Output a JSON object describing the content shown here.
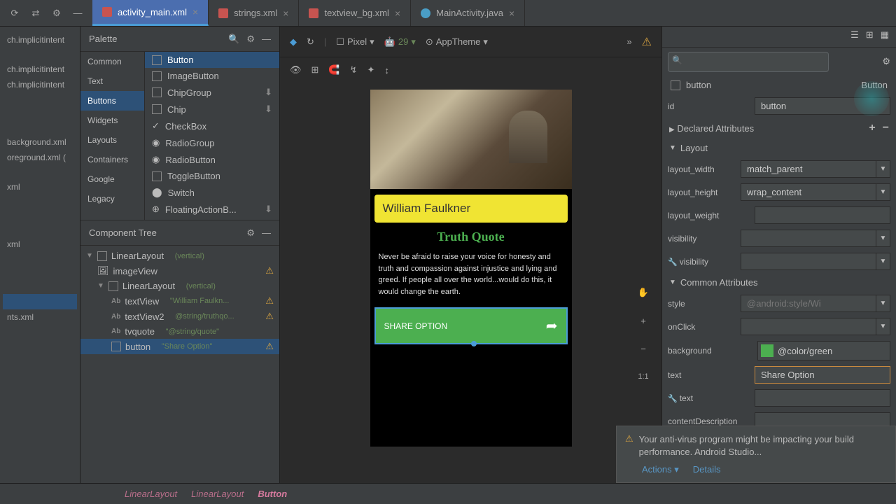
{
  "tabs": [
    {
      "label": "activity_main.xml",
      "active": true,
      "type": "xml"
    },
    {
      "label": "strings.xml",
      "active": false,
      "type": "xml"
    },
    {
      "label": "textview_bg.xml",
      "active": false,
      "type": "xml"
    },
    {
      "label": "MainActivity.java",
      "active": false,
      "type": "java"
    }
  ],
  "project": {
    "items": [
      {
        "label": "ch.implicitintent",
        "sel": false
      },
      {
        "label": "ch.implicitintent",
        "sel": false
      },
      {
        "label": "ch.implicitintent",
        "sel": false
      },
      {
        "label": "background.xml",
        "sel": false
      },
      {
        "label": "oreground.xml (",
        "sel": false
      },
      {
        "label": "xml",
        "sel": false
      },
      {
        "label": "xml",
        "sel": false
      },
      {
        "label": "",
        "sel": true
      },
      {
        "label": "nts.xml",
        "sel": false
      }
    ]
  },
  "palette": {
    "title": "Palette",
    "categories": [
      "Common",
      "Text",
      "Buttons",
      "Widgets",
      "Layouts",
      "Containers",
      "Google",
      "Legacy"
    ],
    "activeCategory": "Buttons",
    "items": [
      {
        "label": "Button",
        "dl": false,
        "active": true
      },
      {
        "label": "ImageButton",
        "dl": false
      },
      {
        "label": "ChipGroup",
        "dl": true
      },
      {
        "label": "Chip",
        "dl": true
      },
      {
        "label": "CheckBox",
        "dl": false
      },
      {
        "label": "RadioGroup",
        "dl": false
      },
      {
        "label": "RadioButton",
        "dl": false
      },
      {
        "label": "ToggleButton",
        "dl": false
      },
      {
        "label": "Switch",
        "dl": false
      },
      {
        "label": "FloatingActionB...",
        "dl": true
      }
    ]
  },
  "tree": {
    "title": "Component Tree",
    "items": [
      {
        "label": "LinearLayout",
        "detail": "(vertical)",
        "indent": 0,
        "icon": "layout",
        "arrow": "▼"
      },
      {
        "label": "imageView",
        "detail": "",
        "indent": 1,
        "icon": "image",
        "warn": true
      },
      {
        "label": "LinearLayout",
        "detail": "(vertical)",
        "indent": 1,
        "icon": "layout",
        "arrow": "▼"
      },
      {
        "label": "textView",
        "detail": "\"William Faulkn...",
        "indent": 2,
        "icon": "ab",
        "warn": true
      },
      {
        "label": "textView2",
        "detail": "@string/truthqo...",
        "indent": 2,
        "icon": "ab",
        "warn": true
      },
      {
        "label": "tvquote",
        "detail": "\"@string/quote\"",
        "indent": 2,
        "icon": "ab"
      },
      {
        "label": "button",
        "detail": "\"Share Option\"",
        "indent": 2,
        "icon": "button",
        "warn": true,
        "sel": true
      }
    ]
  },
  "designer": {
    "device": "Pixel",
    "api": "29",
    "theme": "AppTheme",
    "preview": {
      "name": "William Faulkner",
      "title": "Truth Quote",
      "body": "Never be afraid to raise your voice for honesty and truth and compassion against injustice and lying and greed. If people all over the world...would do this, it would change the earth.",
      "button": "SHARE OPTION"
    }
  },
  "attributes": {
    "component": "button",
    "componentType": "Button",
    "id": "button",
    "sections": {
      "declared": "Declared Attributes",
      "layout": "Layout",
      "common": "Common Attributes"
    },
    "layout": {
      "width_label": "layout_width",
      "width": "match_parent",
      "height_label": "layout_height",
      "height": "wrap_content",
      "weight_label": "layout_weight",
      "weight": "",
      "visibility_label": "visibility",
      "visibility": "",
      "visibility2_label": "visibility",
      "visibility2": ""
    },
    "common": {
      "style_label": "style",
      "style": "@android:style/Wi",
      "onclick_label": "onClick",
      "onclick": "",
      "background_label": "background",
      "background": "@color/green",
      "text_label": "text",
      "text": "Share Option",
      "text2_label": "text",
      "text2": "",
      "cd_label": "contentDescription",
      "cd": ""
    }
  },
  "notification": {
    "text": "Your anti-virus program might be impacting your build performance. Android Studio...",
    "actions": "Actions",
    "details": "Details"
  },
  "breadcrumb": [
    "LinearLayout",
    "LinearLayout",
    "Button"
  ]
}
